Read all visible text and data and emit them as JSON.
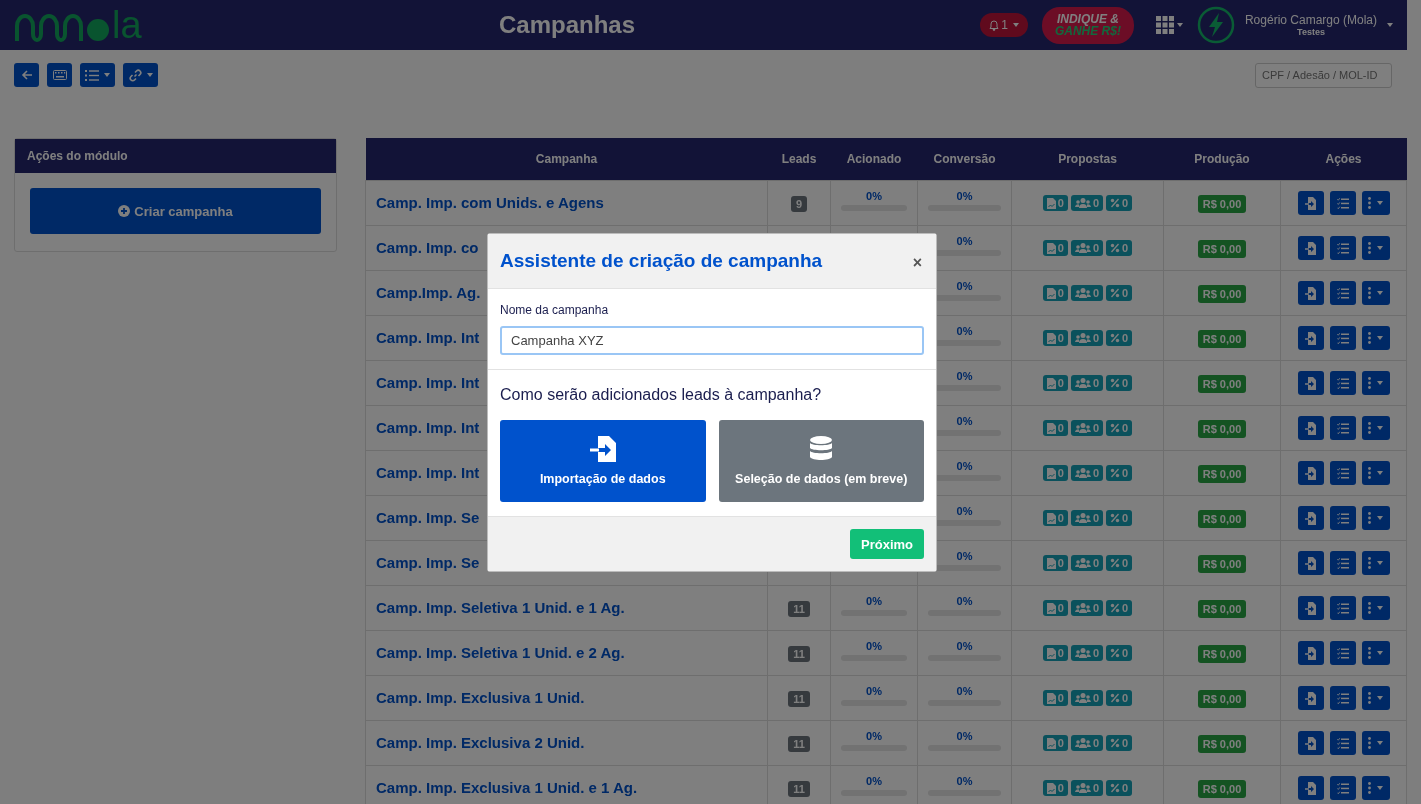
{
  "navbar": {
    "logo_text": "la",
    "title": "Campanhas",
    "notifications": "1",
    "promo": [
      "INDIQUE &",
      "GANHE R$!"
    ],
    "user_name": "Rogério Camargo (Mola)",
    "user_org": "Testes"
  },
  "search": {
    "placeholder": "CPF / Adesão / MOL-ID"
  },
  "sidebar": {
    "title": "Ações do módulo",
    "button": "Criar campanha"
  },
  "table": {
    "columns": [
      "Campanha",
      "Leads",
      "Acionado",
      "Conversão",
      "Propostas",
      "Produção",
      "Ações"
    ],
    "rows": [
      {
        "name": "Camp. Imp. com Unids. e Agens",
        "leads": "9",
        "acionado": {
          "reading": "0%",
          "level": 0
        },
        "conversao": {
          "reading": "0%",
          "level": 0
        },
        "propostas": [
          "0",
          "0",
          "0"
        ],
        "producao": "R$ 0,00"
      },
      {
        "name": "Camp. Imp. co",
        "conversao": {
          "reading": "0%",
          "level": 0
        },
        "propostas": [
          "0",
          "0",
          "0"
        ],
        "producao": "R$ 0,00"
      },
      {
        "name": "Camp.Imp. Ag.",
        "conversao": {
          "reading": "0%",
          "level": 0
        },
        "propostas": [
          "0",
          "0",
          "0"
        ],
        "producao": "R$ 0,00"
      },
      {
        "name": "Camp. Imp. Int",
        "conversao": {
          "reading": "0%",
          "level": 0
        },
        "propostas": [
          "0",
          "0",
          "0"
        ],
        "producao": "R$ 0,00"
      },
      {
        "name": "Camp. Imp. Int",
        "conversao": {
          "reading": "0%",
          "level": 0
        },
        "propostas": [
          "0",
          "0",
          "0"
        ],
        "producao": "R$ 0,00"
      },
      {
        "name": "Camp. Imp. Int",
        "conversao": {
          "reading": "0%",
          "level": 0
        },
        "propostas": [
          "0",
          "0",
          "0"
        ],
        "producao": "R$ 0,00"
      },
      {
        "name": "Camp. Imp. Int",
        "conversao": {
          "reading": "0%",
          "level": 0
        },
        "propostas": [
          "0",
          "0",
          "0"
        ],
        "producao": "R$ 0,00"
      },
      {
        "name": "Camp. Imp. Se",
        "conversao": {
          "reading": "0%",
          "level": 0
        },
        "propostas": [
          "0",
          "0",
          "0"
        ],
        "producao": "R$ 0,00"
      },
      {
        "name": "Camp. Imp. Se",
        "conversao": {
          "reading": "0%",
          "level": 0
        },
        "propostas": [
          "0",
          "0",
          "0"
        ],
        "producao": "R$ 0,00"
      },
      {
        "name": "Camp. Imp. Seletiva 1 Unid. e 1 Ag.",
        "leads": "11",
        "acionado": {
          "reading": "0%",
          "level": 0
        },
        "conversao": {
          "reading": "0%",
          "level": 0
        },
        "propostas": [
          "0",
          "0",
          "0"
        ],
        "producao": "R$ 0,00"
      },
      {
        "name": "Camp. Imp. Seletiva 1 Unid. e 2 Ag.",
        "leads": "11",
        "acionado": {
          "reading": "0%",
          "level": 0
        },
        "conversao": {
          "reading": "0%",
          "level": 0
        },
        "propostas": [
          "0",
          "0",
          "0"
        ],
        "producao": "R$ 0,00"
      },
      {
        "name": "Camp. Imp. Exclusiva 1 Unid.",
        "leads": "11",
        "acionado": {
          "reading": "0%",
          "level": 0
        },
        "conversao": {
          "reading": "0%",
          "level": 0
        },
        "propostas": [
          "0",
          "0",
          "0"
        ],
        "producao": "R$ 0,00"
      },
      {
        "name": "Camp. Imp. Exclusiva 2 Unid.",
        "leads": "11",
        "acionado": {
          "reading": "0%",
          "level": 0
        },
        "conversao": {
          "reading": "0%",
          "level": 0
        },
        "propostas": [
          "0",
          "0",
          "0"
        ],
        "producao": "R$ 0,00"
      },
      {
        "name": "Camp. Imp. Exclusiva 1 Unid. e 1 Ag.",
        "leads": "11",
        "acionado": {
          "reading": "0%",
          "level": 0
        },
        "conversao": {
          "reading": "0%",
          "level": 0
        },
        "propostas": [
          "0",
          "0",
          "0"
        ],
        "producao": "R$ 0,00"
      }
    ]
  },
  "modal": {
    "title": "Assistente de criação de campanha",
    "close": "×",
    "field_label": "Nome da campanha",
    "field_value": "Campanha XYZ",
    "question": "Como serão adicionados leads à campanha?",
    "options": [
      {
        "kind": "import",
        "label": "Importação de dados",
        "selected": true
      },
      {
        "kind": "database",
        "label": "Seleção de dados (em breve)",
        "selected": false
      }
    ],
    "next_button": "Próximo"
  }
}
